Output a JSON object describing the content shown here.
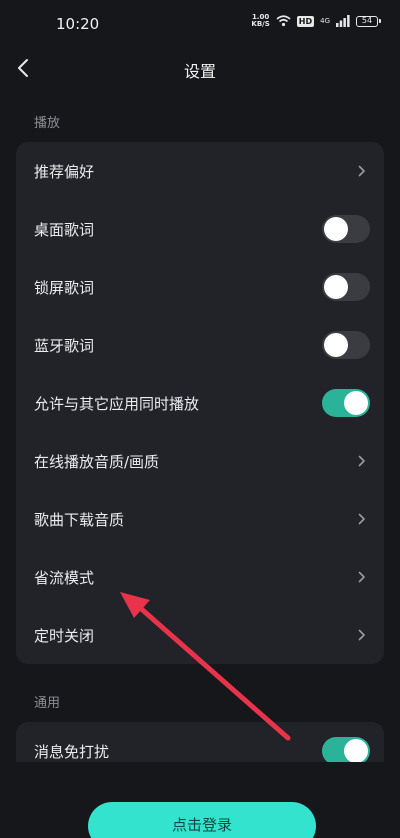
{
  "status_bar": {
    "time": "10:20",
    "speed_value": "1.00",
    "speed_unit": "KB/S",
    "hd": "HD",
    "network": "4G",
    "battery": "54"
  },
  "header": {
    "title": "设置"
  },
  "sections": [
    {
      "label": "播放",
      "items": [
        {
          "label": "推荐偏好",
          "control": "chevron"
        },
        {
          "label": "桌面歌词",
          "control": "toggle",
          "on": false
        },
        {
          "label": "锁屏歌词",
          "control": "toggle",
          "on": false
        },
        {
          "label": "蓝牙歌词",
          "control": "toggle",
          "on": false
        },
        {
          "label": "允许与其它应用同时播放",
          "control": "toggle",
          "on": true
        },
        {
          "label": "在线播放音质/画质",
          "control": "chevron"
        },
        {
          "label": "歌曲下载音质",
          "control": "chevron"
        },
        {
          "label": "省流模式",
          "control": "chevron"
        },
        {
          "label": "定时关闭",
          "control": "chevron"
        }
      ]
    },
    {
      "label": "通用",
      "items": [
        {
          "label": "消息免打扰",
          "control": "toggle",
          "on": true
        }
      ]
    }
  ],
  "login_button": {
    "label": "点击登录"
  },
  "colors": {
    "background": "#16171b",
    "card": "#222328",
    "toggle_on": "#2bb39a",
    "toggle_off": "#3b3c42",
    "login_button": "#33e3cd",
    "annotation_arrow": "#e8334a"
  },
  "annotation": {
    "icon": "red-arrow-pointing-to-item",
    "target_item": "省流模式"
  }
}
